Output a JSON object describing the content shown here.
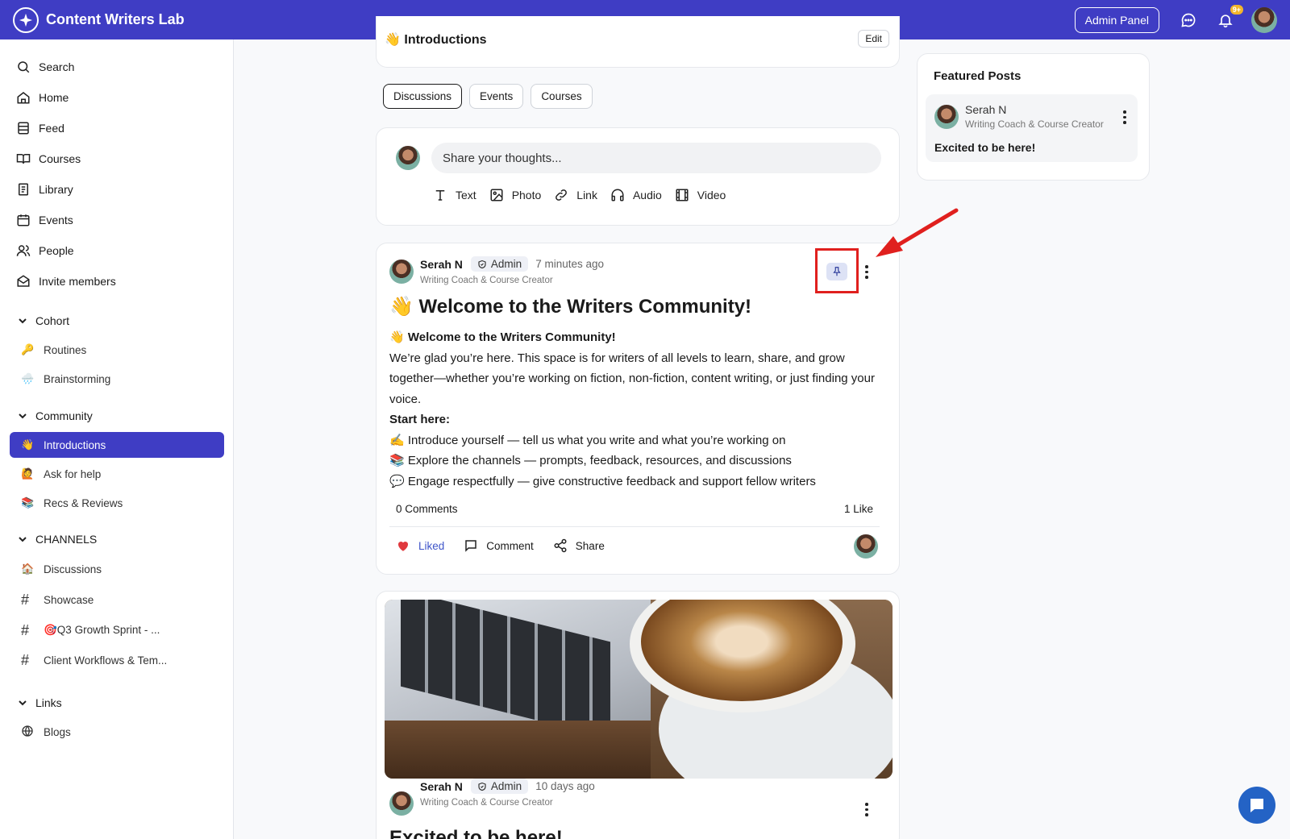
{
  "app": {
    "title": "Content Writers Lab",
    "admin_panel": "Admin Panel",
    "notif_count": "9+"
  },
  "sidebar": {
    "nav": [
      {
        "label": "Search",
        "icon": "search-icon"
      },
      {
        "label": "Home",
        "icon": "home-icon"
      },
      {
        "label": "Feed",
        "icon": "feed-icon"
      },
      {
        "label": "Courses",
        "icon": "book-icon"
      },
      {
        "label": "Library",
        "icon": "library-icon"
      },
      {
        "label": "Events",
        "icon": "calendar-icon"
      },
      {
        "label": "People",
        "icon": "people-icon"
      },
      {
        "label": "Invite members",
        "icon": "mail-icon"
      }
    ],
    "cohort": {
      "label": "Cohort",
      "items": [
        {
          "emoji": "🔑",
          "label": "Routines"
        },
        {
          "emoji": "🌧️",
          "label": "Brainstorming"
        }
      ]
    },
    "community": {
      "label": "Community",
      "items": [
        {
          "emoji": "👋",
          "label": "Introductions"
        },
        {
          "emoji": "🙋",
          "label": "Ask for help"
        },
        {
          "emoji": "📚",
          "label": "Recs & Reviews"
        }
      ]
    },
    "channels": {
      "label": "CHANNELS",
      "items": [
        {
          "emoji": "🏠",
          "label": "Discussions"
        },
        {
          "label": "Showcase"
        },
        {
          "label": "🎯Q3 Growth Sprint - ..."
        },
        {
          "label": "Client Workflows & Tem..."
        }
      ]
    },
    "links": {
      "label": "Links",
      "items": [
        {
          "label": "Blogs"
        }
      ]
    }
  },
  "header_card": {
    "title": "👋 Introductions",
    "edit": "Edit"
  },
  "tabs": [
    "Discussions",
    "Events",
    "Courses"
  ],
  "composer": {
    "placeholder": "Share your thoughts...",
    "actions": [
      "Text",
      "Photo",
      "Link",
      "Audio",
      "Video"
    ]
  },
  "post1": {
    "author": "Serah N",
    "role": "Admin",
    "time": "7 minutes ago",
    "subtitle": "Writing Coach & Course Creator",
    "title": "👋 Welcome to the Writers Community!",
    "body_heading": "👋 Welcome to the Writers Community!",
    "body_para": "We’re glad you’re here. This space is for writers of all levels to learn, share, and grow together—whether you’re working on fiction, non-fiction, content writing, or just finding your voice.",
    "start_here": "Start here:",
    "bullets": [
      "✍️ Introduce yourself — tell us what you write and what you’re working on",
      "📚 Explore the channels — prompts, feedback, resources, and discussions",
      "💬 Engage respectfully — give constructive feedback and support fellow writers"
    ],
    "comments": "0 Comments",
    "likes": "1 Like",
    "liked": "Liked",
    "comment": "Comment",
    "share": "Share"
  },
  "post2": {
    "author": "Serah N",
    "role": "Admin",
    "time": "10 days ago",
    "subtitle": "Writing Coach & Course Creator",
    "title": "Excited to be here!"
  },
  "featured": {
    "title": "Featured Posts",
    "author": "Serah N",
    "subtitle": "Writing Coach & Course Creator",
    "text": "Excited to be here!"
  },
  "colors": {
    "brand": "#3f3dc4",
    "highlight": "#e0201e",
    "like": "#e0393e"
  }
}
